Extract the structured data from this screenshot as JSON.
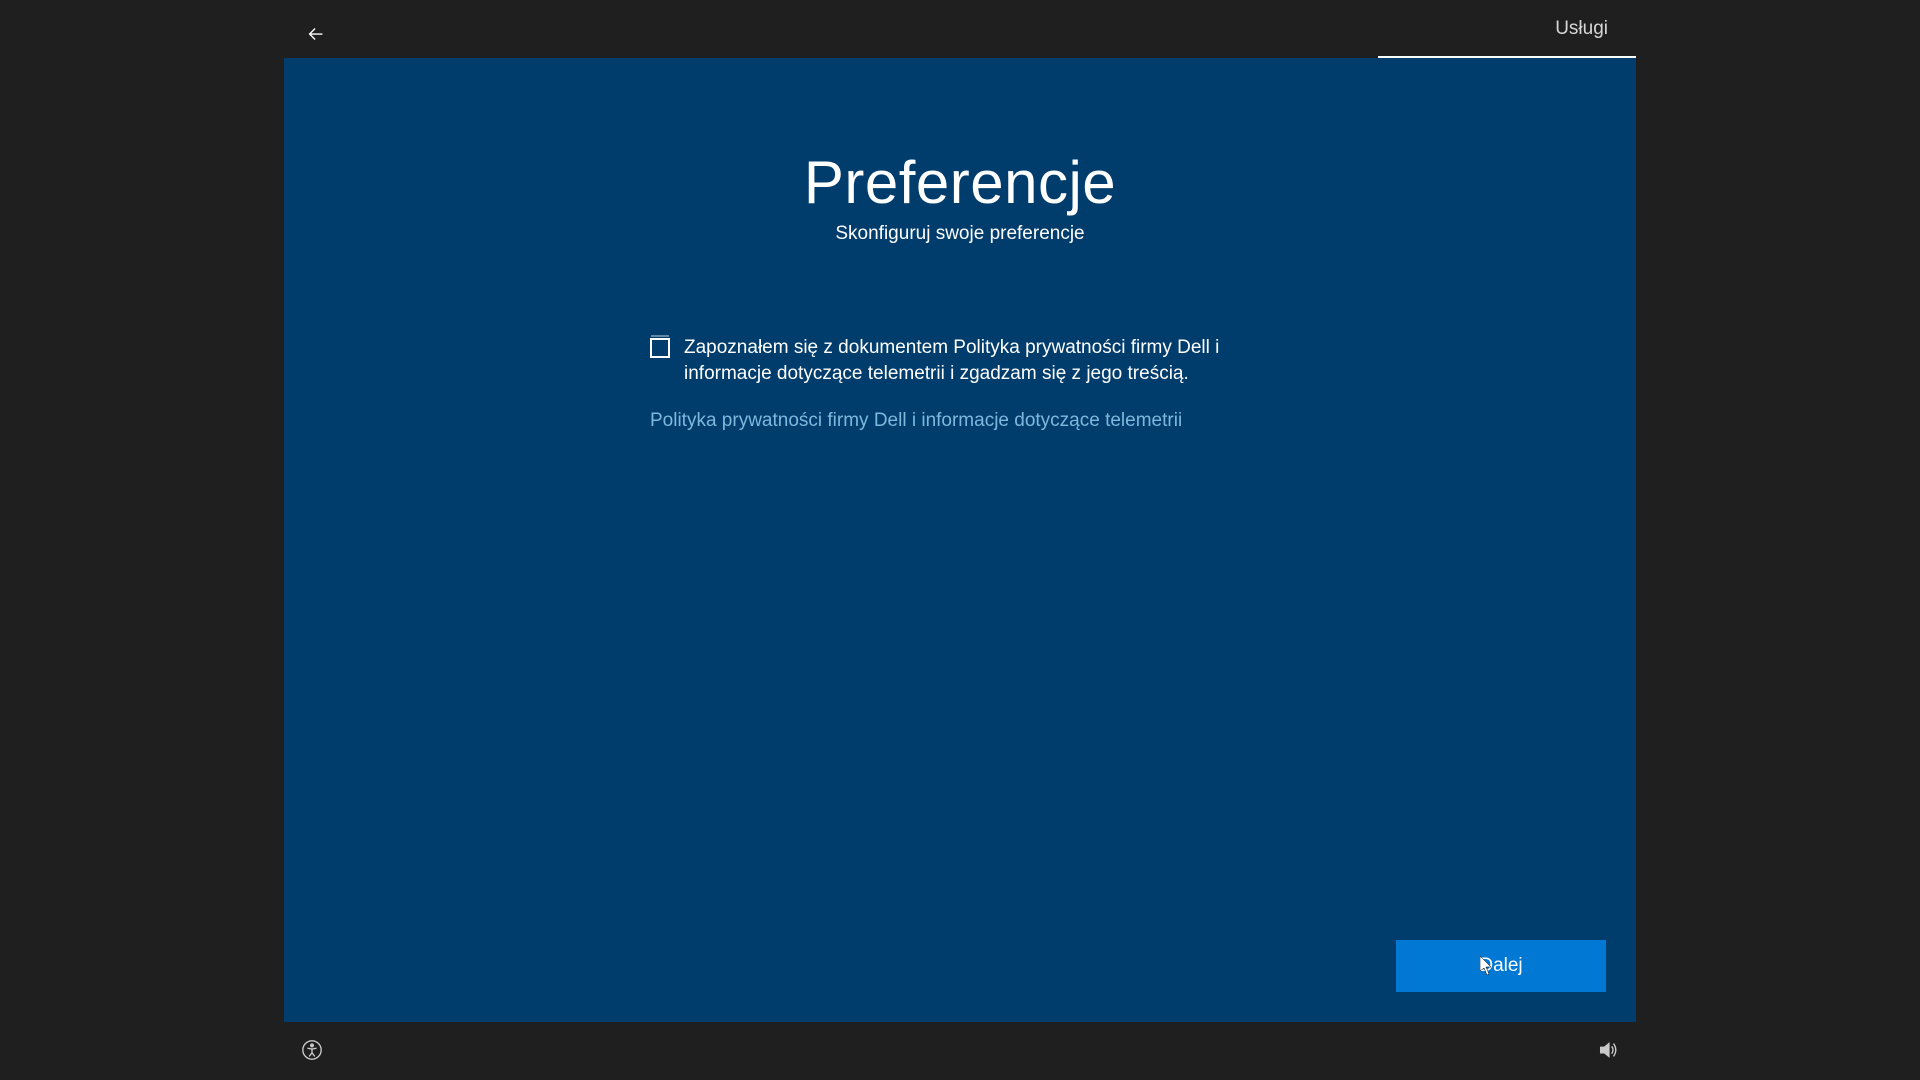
{
  "header": {
    "tab_label": "Usługi"
  },
  "page": {
    "title": "Preferencje",
    "subtitle": "Skonfiguruj swoje preferencje"
  },
  "form": {
    "checkbox_label": "Zapoznałem się z dokumentem Polityka prywatności firmy Dell i informacje dotyczące telemetrii i zgadzam się z jego treścią.",
    "privacy_link": "Polityka prywatności firmy Dell i informacje dotyczące telemetrii"
  },
  "actions": {
    "next_label": "Dalej"
  }
}
